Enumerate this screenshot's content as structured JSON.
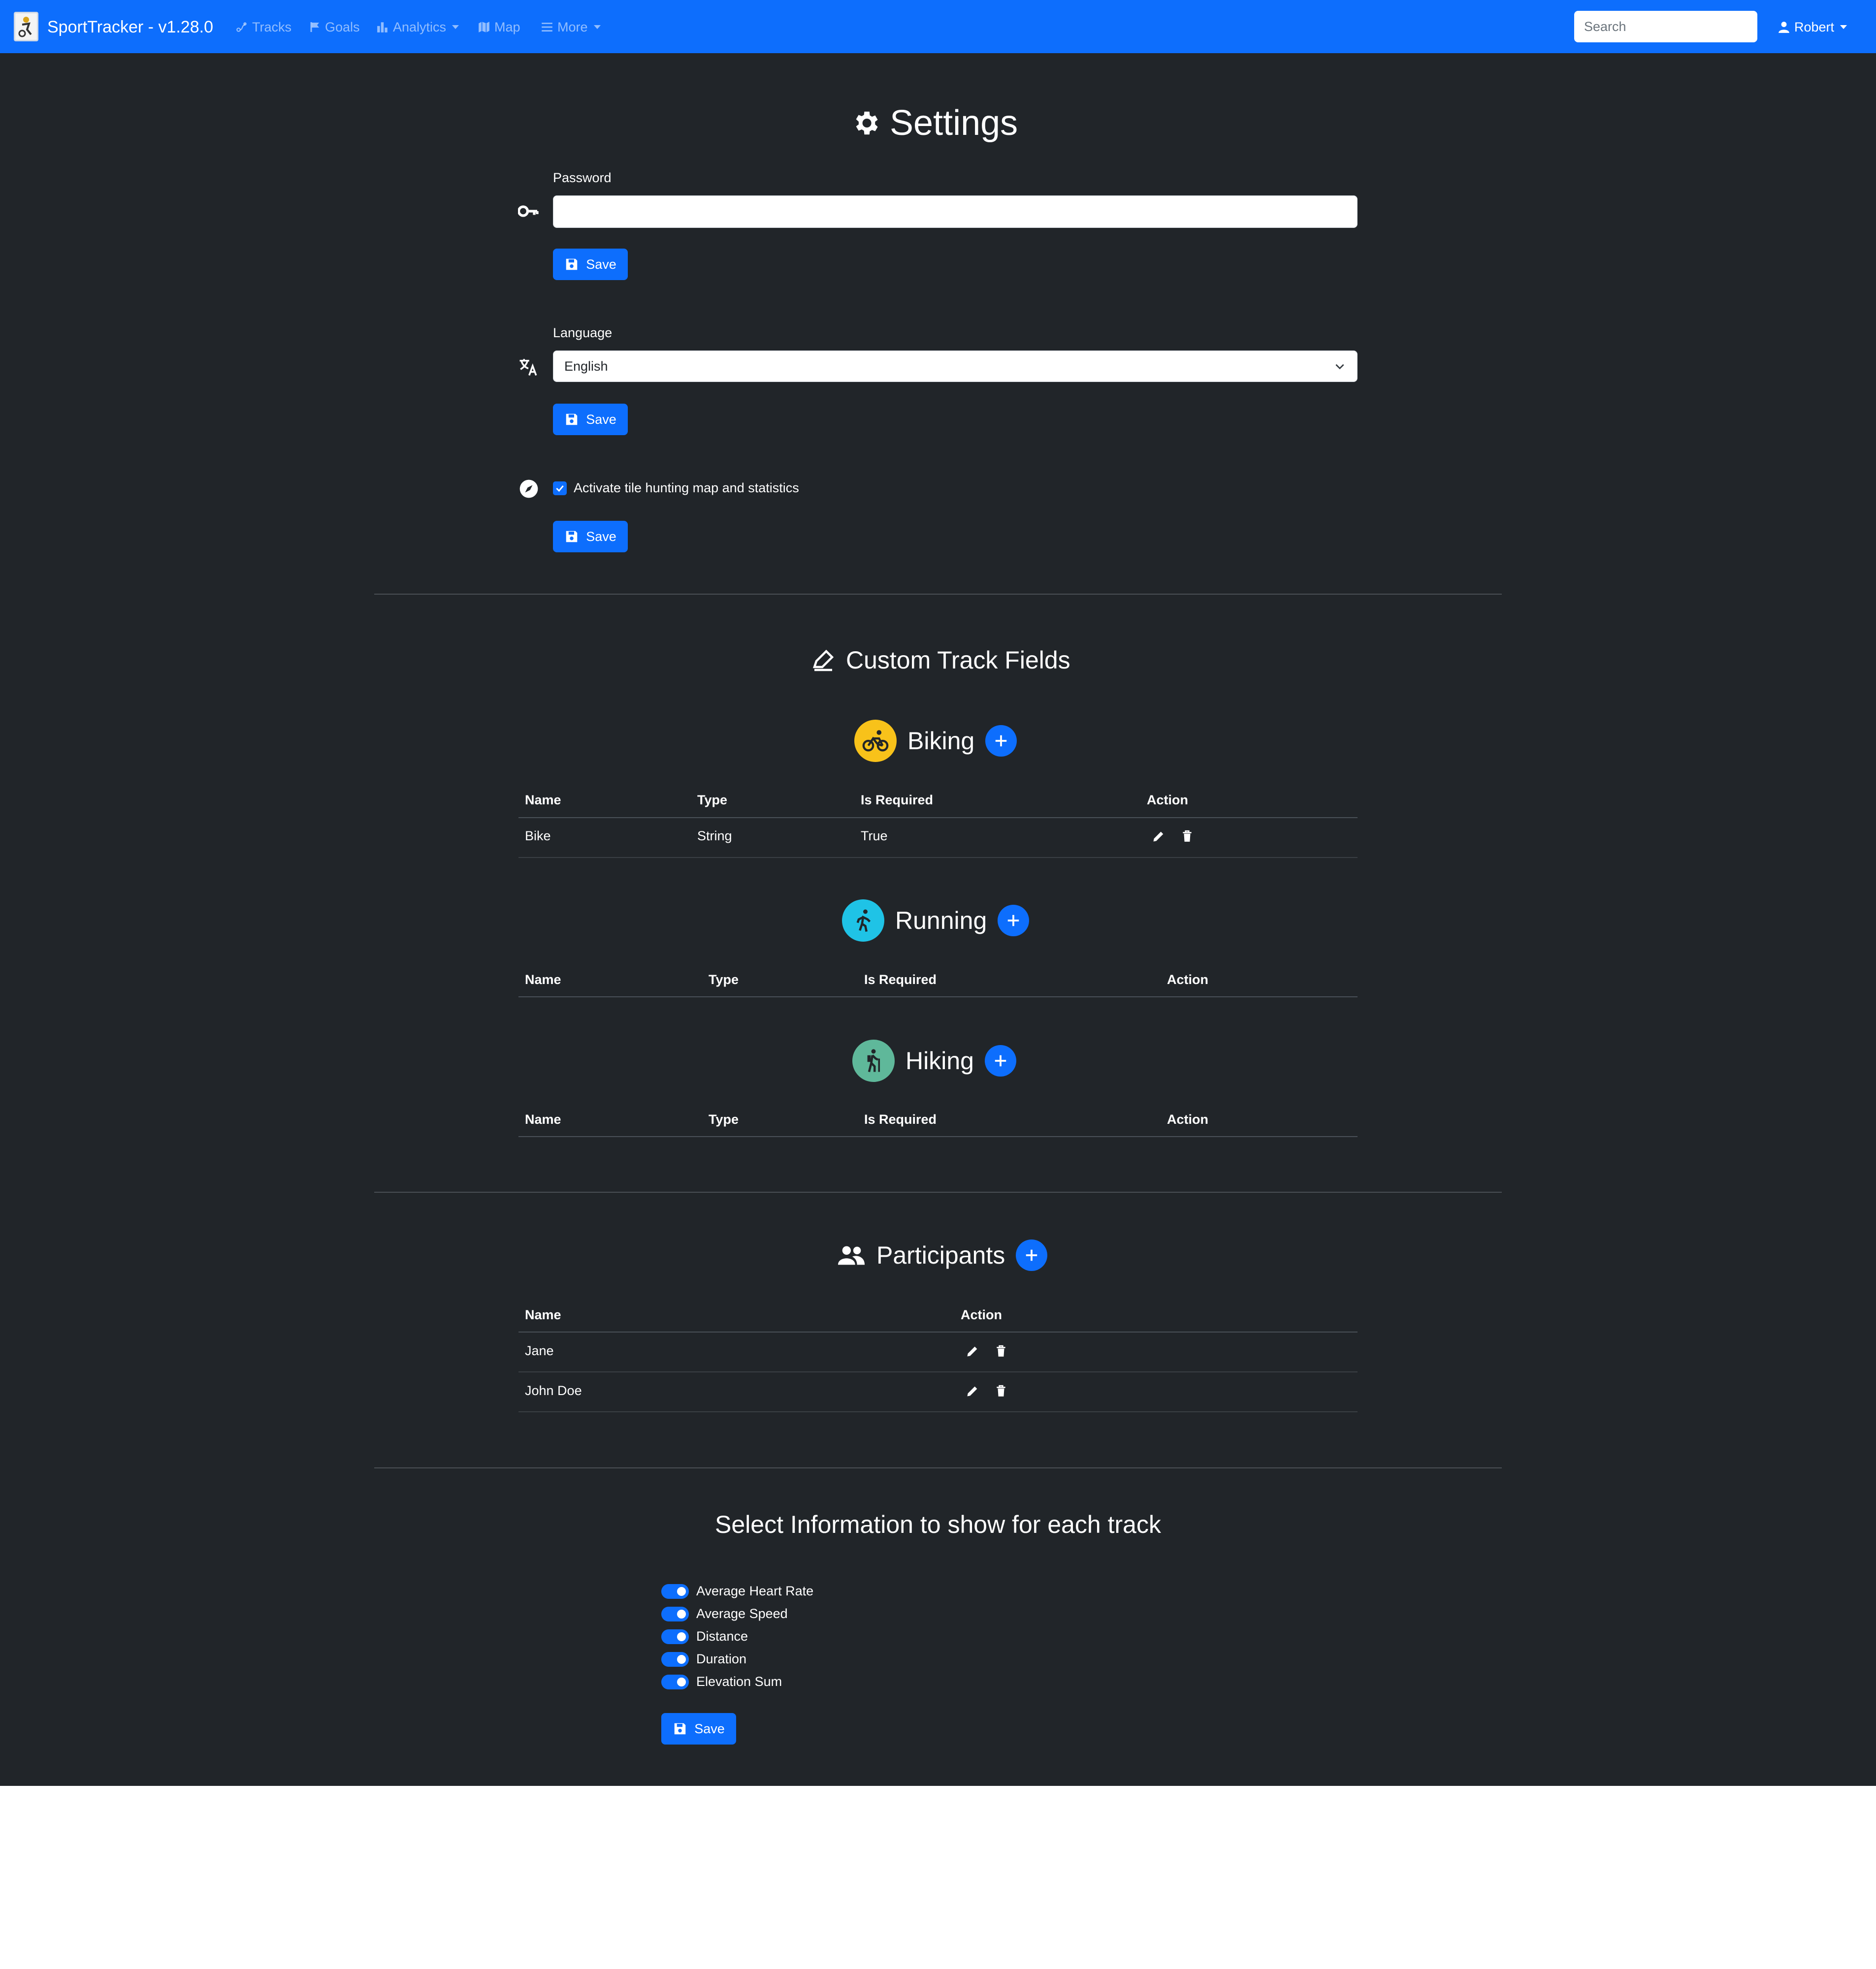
{
  "navbar": {
    "brand": "SportTracker - v1.28.0",
    "links": [
      {
        "label": "Tracks",
        "icon": "tracks-icon"
      },
      {
        "label": "Goals",
        "icon": "flag-icon"
      },
      {
        "label": "Analytics",
        "icon": "bar-chart-icon",
        "dropdown": true
      },
      {
        "label": "Map",
        "icon": "map-icon"
      },
      {
        "label": "More",
        "icon": "list-icon",
        "dropdown": true
      }
    ],
    "search_placeholder": "Search",
    "user": "Robert"
  },
  "settings": {
    "title": "Settings",
    "password_label": "Password",
    "password_value": "",
    "language_label": "Language",
    "language_value": "English",
    "tile_hunting_label": "Activate tile hunting map and statistics",
    "tile_hunting_checked": true,
    "save_label": "Save"
  },
  "custom_fields": {
    "title": "Custom Track Fields",
    "columns": [
      "Name",
      "Type",
      "Is Required",
      "Action"
    ],
    "sports": [
      {
        "name": "Biking",
        "color": "#f8c21a",
        "rows": [
          {
            "name": "Bike",
            "type": "String",
            "required": "True"
          }
        ]
      },
      {
        "name": "Running",
        "color": "#1fc3e6",
        "rows": []
      },
      {
        "name": "Hiking",
        "color": "#5fb89a",
        "rows": []
      }
    ]
  },
  "participants": {
    "title": "Participants",
    "columns": [
      "Name",
      "Action"
    ],
    "rows": [
      "Jane",
      "John Doe"
    ]
  },
  "track_info": {
    "title": "Select Information to show for each track",
    "options": [
      "Average Heart Rate",
      "Average Speed",
      "Distance",
      "Duration",
      "Elevation Sum"
    ],
    "save_label": "Save"
  },
  "colors": {
    "primary": "#0d6efd",
    "background": "#212529"
  }
}
